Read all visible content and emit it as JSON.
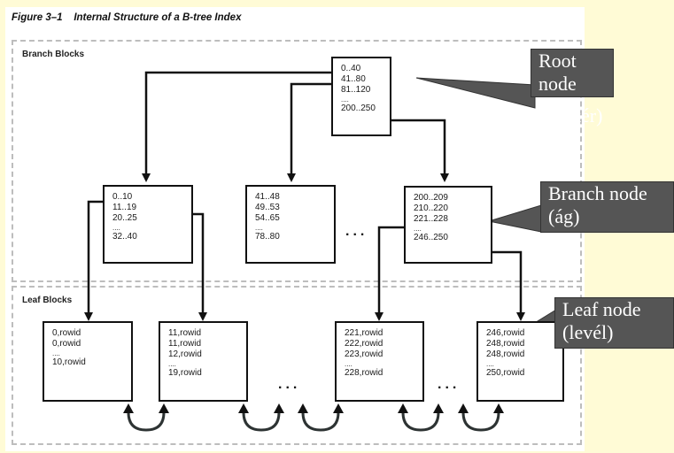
{
  "figure": {
    "number": "Figure 3–1",
    "title": "Internal Structure of a B-tree Index"
  },
  "areas": {
    "branch_label": "Branch Blocks",
    "leaf_label": "Leaf Blocks"
  },
  "root_node": {
    "entries": [
      "0..40",
      "41..80",
      "81..120",
      "....",
      "200..250"
    ]
  },
  "branch_nodes": [
    {
      "entries": [
        "0..10",
        "11..19",
        "20..25",
        "....",
        "32..40"
      ]
    },
    {
      "entries": [
        "41..48",
        "49..53",
        "54..65",
        "....",
        "78..80"
      ]
    },
    {
      "entries": [
        "200..209",
        "210..220",
        "221..228",
        "....",
        "246..250"
      ]
    }
  ],
  "leaf_nodes": [
    {
      "entries": [
        "0,rowid",
        "0,rowid",
        "....",
        "10,rowid"
      ]
    },
    {
      "entries": [
        "11,rowid",
        "11,rowid",
        "12,rowid",
        "....",
        "19,rowid"
      ]
    },
    {
      "entries": [
        "221,rowid",
        "222,rowid",
        "223,rowid",
        "....",
        "228,rowid"
      ]
    },
    {
      "entries": [
        "246,rowid",
        "248,rowid",
        "248,rowid",
        "....",
        "250,rowid"
      ]
    }
  ],
  "ellipsis": "...",
  "callouts": {
    "root": "Root node",
    "root_ghost": "kér)",
    "branch": "Branch node (ág)",
    "leaf": "Leaf node (levél)"
  },
  "colors": {
    "slide_background": "#fffbd6",
    "callout_fill": "#555555",
    "dashed_border": "#bdbdbd"
  }
}
